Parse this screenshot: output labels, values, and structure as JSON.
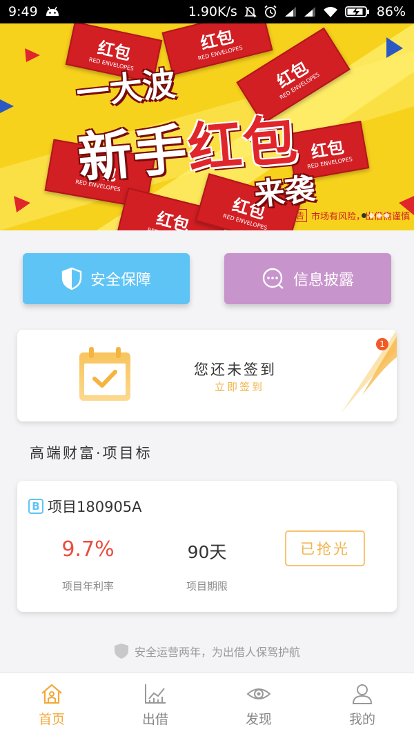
{
  "status_bar": {
    "time": "9:49",
    "speed": "1.90K/s",
    "battery": "86%",
    "icons": [
      "android-icon",
      "mute-icon",
      "alarm-icon",
      "signal-icon",
      "signal-icon",
      "wifi-icon",
      "battery-charging-icon"
    ]
  },
  "banner": {
    "line1": "一大波",
    "line2_a": "新手",
    "line2_b": "红包",
    "line3": "来袭",
    "envelope_text": "红包",
    "envelope_sub": "RED ENVELOPES",
    "ad_tag": "广告",
    "ad_text": "市场有风险，出借需谨慎",
    "slide_count": 4,
    "active_slide": 0
  },
  "actions": {
    "safety_label": "安全保障",
    "info_label": "信息披露"
  },
  "checkin": {
    "title": "您还未签到",
    "action": "立即签到",
    "badge": "1"
  },
  "section": {
    "title": "高端财富·项目标"
  },
  "project": {
    "type_badge": "B",
    "name": "项目180905A",
    "rate": "9.7%",
    "rate_label": "项目年利率",
    "term": "90天",
    "term_label": "项目期限",
    "status": "已抢光"
  },
  "footer_note": "安全运营两年，为出借人保驾护航",
  "tabs": [
    {
      "label": "首页",
      "icon": "home-icon",
      "active": true
    },
    {
      "label": "出借",
      "icon": "chart-icon",
      "active": false
    },
    {
      "label": "发现",
      "icon": "eye-icon",
      "active": false
    },
    {
      "label": "我的",
      "icon": "user-icon",
      "active": false
    }
  ],
  "colors": {
    "accent": "#f2a93b",
    "safety_button": "#5ec4f6",
    "info_button": "#c894cc",
    "rate_red": "#e84e40",
    "banner_yellow": "#f7d21c"
  }
}
